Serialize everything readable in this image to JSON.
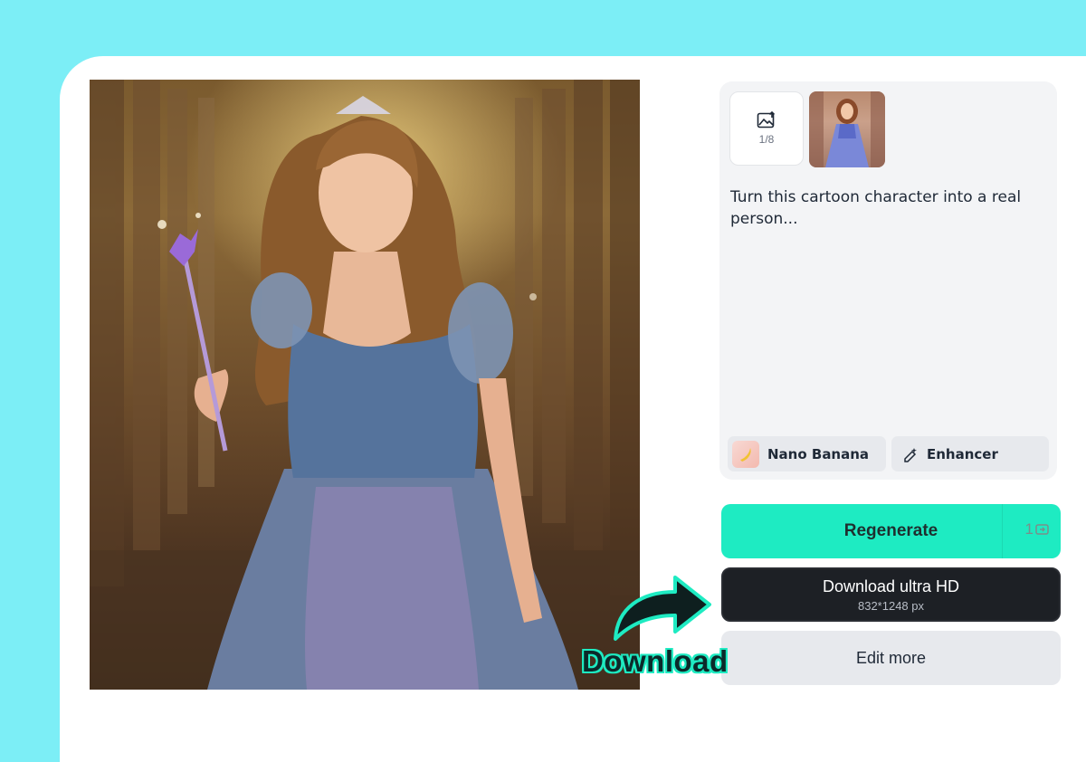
{
  "result_image": {
    "icon": "princess-photo-image"
  },
  "upload": {
    "icon": "image-upload-icon",
    "count": "1/8"
  },
  "reference_thumbnail": {
    "icon": "cartoon-princess-thumbnail"
  },
  "prompt_text": "Turn this cartoon character into a real person...",
  "options": {
    "model_label": "Nano Banana",
    "enhancer_label": "Enhancer"
  },
  "actions": {
    "regenerate_label": "Regenerate",
    "regenerate_credits": "1",
    "download_label": "Download ultra HD",
    "download_size": "832*1248 px",
    "edit_label": "Edit more"
  },
  "annotation": {
    "label": "Download"
  },
  "colors": {
    "background": "#7ceef6",
    "accent": "#1eebc2",
    "dark_button": "#1d2025"
  }
}
